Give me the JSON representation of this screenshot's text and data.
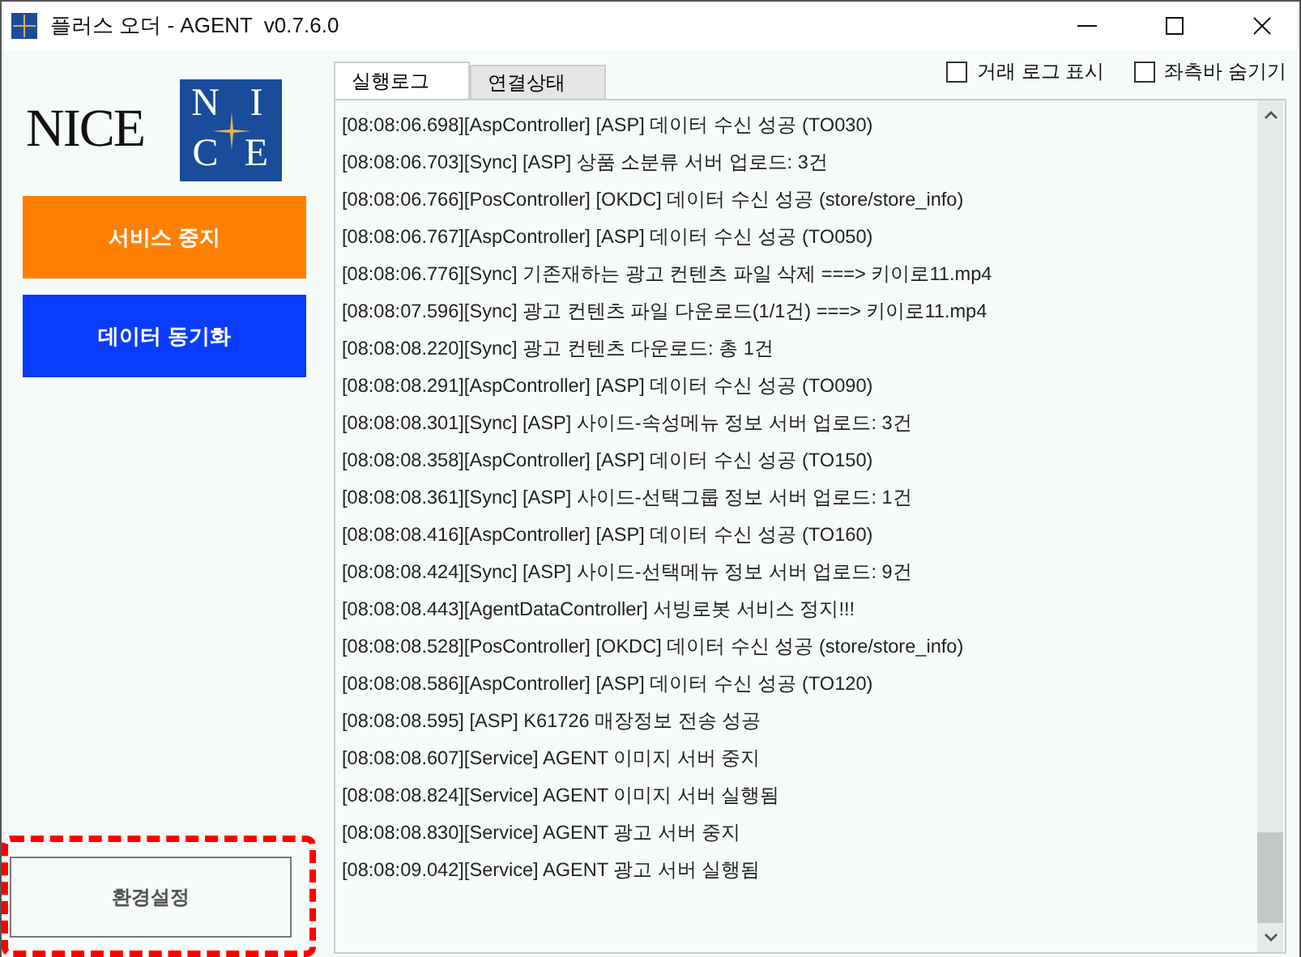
{
  "window": {
    "title": "플러스 오더 - AGENT  v0.7.6.0"
  },
  "logo": {
    "wordmark": "NICE",
    "letters": [
      "N",
      "I",
      "C",
      "E"
    ]
  },
  "sidebar": {
    "buttons": [
      {
        "label": "서비스 중지",
        "kind": "primary",
        "color": "#ff8000"
      },
      {
        "label": "데이터 동기화",
        "kind": "primary",
        "color": "#0a3cff"
      },
      {
        "label": "환경설정",
        "kind": "outline",
        "highlighted": true
      }
    ]
  },
  "tabs": [
    {
      "label": "실행로그",
      "selected": true
    },
    {
      "label": "연결상태",
      "selected": false
    }
  ],
  "options": [
    {
      "label": "거래 로그 표시",
      "checked": false
    },
    {
      "label": "좌측바 숨기기",
      "checked": false
    }
  ],
  "log": [
    "[08:08:06.698][AspController] [ASP] 데이터 수신 성공 (TO030)",
    "[08:08:06.703][Sync] [ASP] 상품 소분류 서버 업로드: 3건",
    "[08:08:06.766][PosController] [OKDC] 데이터 수신 성공 (store/store_info)",
    "[08:08:06.767][AspController] [ASP] 데이터 수신 성공 (TO050)",
    "[08:08:06.776][Sync] 기존재하는 광고 컨텐츠 파일 삭제 ===> 키이로11.mp4",
    "[08:08:07.596][Sync] 광고 컨텐츠 파일 다운로드(1/1건) ===> 키이로11.mp4",
    "[08:08:08.220][Sync] 광고 컨텐츠 다운로드: 총 1건",
    "[08:08:08.291][AspController] [ASP] 데이터 수신 성공 (TO090)",
    "[08:08:08.301][Sync] [ASP] 사이드-속성메뉴 정보 서버 업로드: 3건",
    "[08:08:08.358][AspController] [ASP] 데이터 수신 성공 (TO150)",
    "[08:08:08.361][Sync] [ASP] 사이드-선택그룹 정보 서버 업로드: 1건",
    "[08:08:08.416][AspController] [ASP] 데이터 수신 성공 (TO160)",
    "[08:08:08.424][Sync] [ASP] 사이드-선택메뉴 정보 서버 업로드: 9건",
    "[08:08:08.443][AgentDataController] 서빙로봇 서비스 정지!!!",
    "[08:08:08.528][PosController] [OKDC] 데이터 수신 성공 (store/store_info)",
    "[08:08:08.586][AspController] [ASP] 데이터 수신 성공 (TO120)",
    "[08:08:08.595] [ASP] K61726 매장정보 전송 성공",
    "[08:08:08.607][Service] AGENT 이미지 서버 중지",
    "[08:08:08.824][Service] AGENT 이미지 서버 실행됨",
    "[08:08:08.830][Service] AGENT 광고 서버 중지",
    "[08:08:09.042][Service] AGENT 광고 서버 실행됨"
  ]
}
